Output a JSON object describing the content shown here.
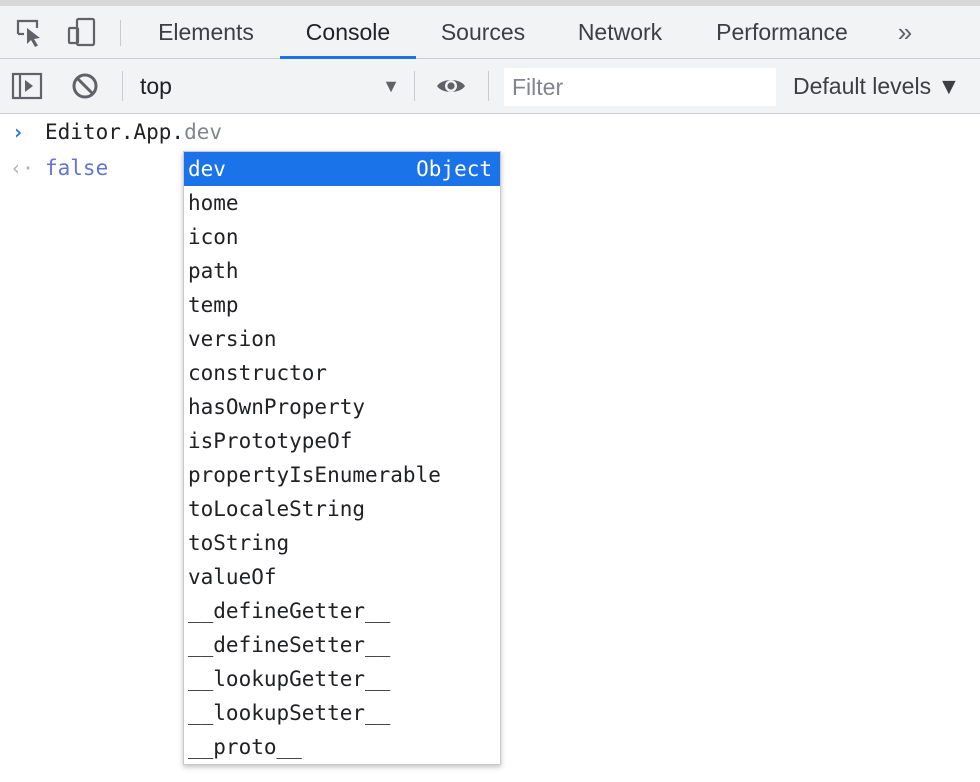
{
  "tabs": [
    {
      "label": "Elements"
    },
    {
      "label": "Console"
    },
    {
      "label": "Sources"
    },
    {
      "label": "Network"
    },
    {
      "label": "Performance"
    }
  ],
  "active_tab": "Console",
  "more_tabs_glyph": "»",
  "toolbar": {
    "context": "top",
    "context_arrow": "▼",
    "filter_placeholder": "Filter",
    "levels": "Default levels ▼"
  },
  "console": {
    "input_typed": "Editor.App.",
    "input_ghost": "dev",
    "prompt_glyph": "›",
    "result_glyph": "‹·",
    "result": "false"
  },
  "autocomplete": {
    "selected_index": 0,
    "selected_type": "Object",
    "items": [
      "dev",
      "home",
      "icon",
      "path",
      "temp",
      "version",
      "constructor",
      "hasOwnProperty",
      "isPrototypeOf",
      "propertyIsEnumerable",
      "toLocaleString",
      "toString",
      "valueOf",
      "__defineGetter__",
      "__defineSetter__",
      "__lookupGetter__",
      "__lookupSetter__",
      "__proto__"
    ]
  },
  "colors": {
    "accent": "#1a73e8",
    "result_text": "#6474d6",
    "toolbar_bg": "#f1f3f4"
  },
  "icons": [
    "inspect-element-icon",
    "device-toolbar-icon",
    "sidebar-toggle-icon",
    "clear-console-icon",
    "eye-icon",
    "more-tabs-icon"
  ]
}
